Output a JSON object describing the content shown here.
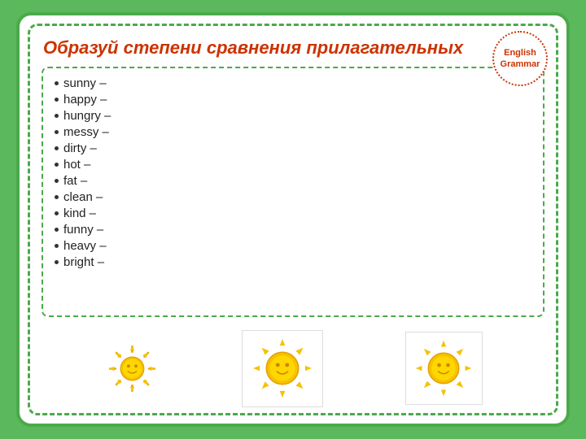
{
  "title": "Образуй степени сравнения прилагательных",
  "badge": {
    "line1": "English",
    "line2": "Grammar"
  },
  "words": [
    "sunny –",
    "happy –",
    "hungry –",
    "messy –",
    "dirty –",
    "hot –",
    "fat –",
    "clean –",
    "kind –",
    "funny –",
    "heavy –",
    "bright –"
  ],
  "suns": [
    {
      "size": "sm"
    },
    {
      "size": "md"
    },
    {
      "size": "lg"
    }
  ]
}
